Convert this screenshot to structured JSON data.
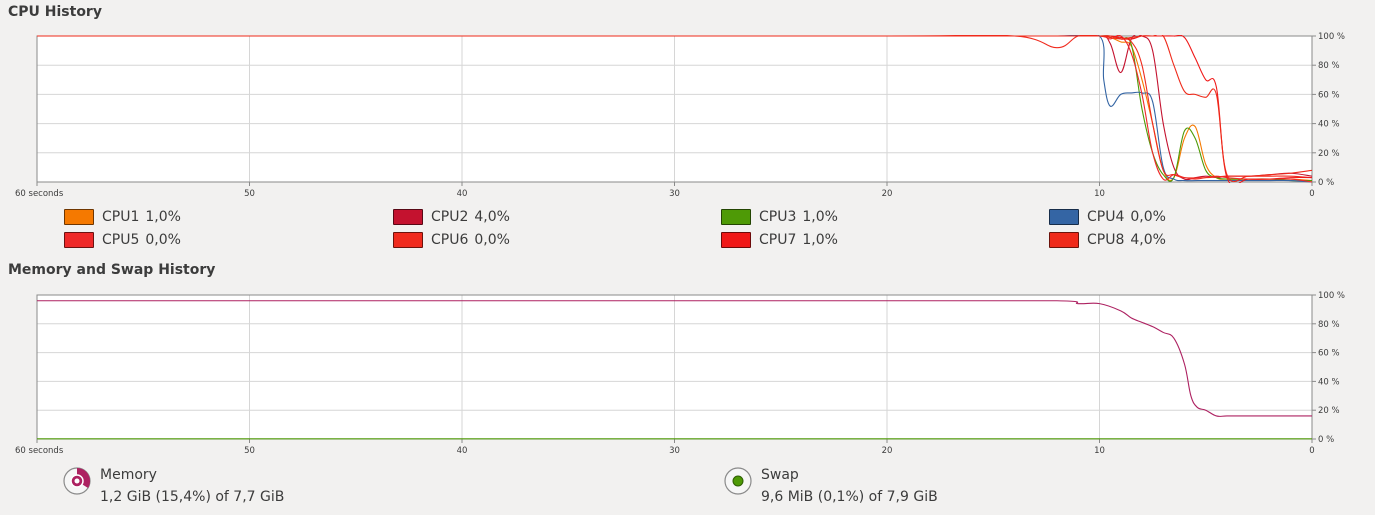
{
  "cpu": {
    "title": "CPU History",
    "x_ticks": [
      "60 seconds",
      "50",
      "40",
      "30",
      "20",
      "10",
      "0"
    ],
    "y_ticks": [
      "100 %",
      "80 %",
      "60 %",
      "40 %",
      "20 %",
      "0 %"
    ],
    "legend": [
      {
        "label": "CPU1",
        "value": "1,0%",
        "color": "#f57900"
      },
      {
        "label": "CPU2",
        "value": "4,0%",
        "color": "#c4122f"
      },
      {
        "label": "CPU3",
        "value": "1,0%",
        "color": "#4e9a06"
      },
      {
        "label": "CPU4",
        "value": "0,0%",
        "color": "#3465a4"
      },
      {
        "label": "CPU5",
        "value": "0,0%",
        "color": "#ef2929"
      },
      {
        "label": "CPU6",
        "value": "0,0%",
        "color": "#f02b1e"
      },
      {
        "label": "CPU7",
        "value": "1,0%",
        "color": "#f01818"
      },
      {
        "label": "CPU8",
        "value": "4,0%",
        "color": "#ef2a1a"
      }
    ]
  },
  "memory": {
    "title": "Memory and Swap History",
    "x_ticks": [
      "60 seconds",
      "50",
      "40",
      "30",
      "20",
      "10",
      "0"
    ],
    "y_ticks": [
      "100 %",
      "80 %",
      "60 %",
      "40 %",
      "20 %",
      "0 %"
    ],
    "memory_label": "Memory",
    "memory_value": "1,2 GiB (15,4%) of 7,7 GiB",
    "memory_color": "#ad2161",
    "swap_label": "Swap",
    "swap_value": "9,6 MiB (0,1%) of 7,9 GiB",
    "swap_color": "#4e9a06"
  },
  "chart_data": [
    {
      "type": "line",
      "title": "CPU History",
      "xlabel": "",
      "ylabel": "",
      "xlim": [
        60,
        0
      ],
      "ylim": [
        0,
        100
      ],
      "grid": true,
      "series": [
        {
          "name": "CPU1",
          "color": "#f57900",
          "x": [
            60,
            40,
            20,
            12,
            10,
            9.5,
            9,
            8.5,
            8,
            7.5,
            7,
            6.5,
            6,
            5.5,
            5,
            4.5,
            4,
            3,
            2,
            1,
            0
          ],
          "y": [
            100,
            100,
            100,
            100,
            100,
            99,
            96,
            93,
            70,
            40,
            8,
            3,
            30,
            38,
            12,
            3,
            2,
            2,
            2,
            2,
            1
          ]
        },
        {
          "name": "CPU2",
          "color": "#c4122f",
          "x": [
            60,
            40,
            20,
            12,
            10,
            9.5,
            9,
            8.5,
            8,
            7.5,
            7,
            6.5,
            6,
            5.5,
            5,
            4.5,
            4,
            3,
            2,
            1,
            0
          ],
          "y": [
            100,
            100,
            100,
            100,
            100,
            95,
            75,
            98,
            100,
            90,
            40,
            10,
            2,
            3,
            4,
            3,
            4,
            4,
            5,
            6,
            4
          ]
        },
        {
          "name": "CPU3",
          "color": "#4e9a06",
          "x": [
            60,
            40,
            20,
            12,
            10,
            9.5,
            9,
            8.5,
            8,
            7.5,
            7,
            6.5,
            6,
            5.5,
            5,
            4.5,
            4,
            3,
            2,
            1,
            0
          ],
          "y": [
            100,
            100,
            100,
            100,
            100,
            100,
            98,
            94,
            50,
            20,
            5,
            3,
            35,
            30,
            8,
            3,
            2,
            2,
            2,
            1,
            1
          ]
        },
        {
          "name": "CPU4",
          "color": "#3465a4",
          "x": [
            60,
            40,
            20,
            12,
            10,
            9.8,
            9.5,
            9,
            8.5,
            8,
            7.5,
            7,
            6.5,
            6,
            5,
            4,
            3,
            2,
            1,
            0
          ],
          "y": [
            100,
            100,
            100,
            100,
            100,
            70,
            52,
            60,
            61,
            61,
            55,
            10,
            2,
            1,
            1,
            1,
            1,
            1,
            1,
            0
          ]
        },
        {
          "name": "CPU5",
          "color": "#ef2929",
          "x": [
            60,
            40,
            20,
            12,
            10,
            9.5,
            9,
            8.5,
            8,
            7.5,
            7,
            6.5,
            6,
            5.5,
            5,
            4.5,
            4,
            3,
            2,
            1,
            0
          ],
          "y": [
            100,
            100,
            100,
            100,
            100,
            98,
            100,
            88,
            60,
            20,
            2,
            5,
            3,
            2,
            3,
            4,
            3,
            2,
            2,
            2,
            0
          ]
        },
        {
          "name": "CPU6",
          "color": "#f02b1e",
          "x": [
            60,
            40,
            20,
            14,
            12,
            11,
            10,
            9.5,
            9,
            8.5,
            8,
            7.5,
            7,
            6.5,
            6,
            5,
            4,
            3,
            2,
            1,
            0
          ],
          "y": [
            100,
            100,
            100,
            100,
            92,
            100,
            100,
            100,
            98,
            96,
            80,
            40,
            8,
            5,
            3,
            3,
            4,
            4,
            4,
            4,
            3
          ]
        },
        {
          "name": "CPU7",
          "color": "#f01818",
          "x": [
            60,
            40,
            20,
            12,
            10,
            9.5,
            9,
            8.5,
            8,
            7.5,
            7,
            6.5,
            6,
            5.5,
            5,
            4.5,
            4,
            3,
            2,
            1,
            0
          ],
          "y": [
            100,
            100,
            100,
            100,
            100,
            100,
            99,
            98,
            100,
            100,
            100,
            100,
            99,
            85,
            70,
            65,
            3,
            2,
            2,
            3,
            3
          ]
        },
        {
          "name": "CPU8",
          "color": "#ef2a1a",
          "x": [
            60,
            40,
            20,
            12,
            10,
            9.5,
            9,
            8.5,
            8,
            7.5,
            7,
            6.5,
            6,
            5.5,
            5,
            4.5,
            4,
            3,
            2,
            1,
            0
          ],
          "y": [
            100,
            100,
            100,
            100,
            100,
            99,
            98,
            99,
            100,
            100,
            100,
            80,
            62,
            60,
            58,
            60,
            5,
            4,
            5,
            6,
            8
          ]
        }
      ]
    },
    {
      "type": "line",
      "title": "Memory and Swap History",
      "xlabel": "",
      "ylabel": "",
      "xlim": [
        60,
        0
      ],
      "ylim": [
        0,
        100
      ],
      "grid": true,
      "series": [
        {
          "name": "Memory",
          "color": "#ad2161",
          "x": [
            60,
            50,
            45,
            40,
            30,
            20,
            12,
            11,
            10,
            9,
            8.5,
            8,
            7.5,
            7,
            6.5,
            6,
            5.7,
            5.4,
            5,
            4.5,
            4,
            3,
            2,
            1,
            0
          ],
          "y": [
            96,
            96,
            96,
            96,
            96,
            96,
            96,
            94,
            94,
            89,
            84,
            81,
            78,
            74,
            70,
            52,
            30,
            22,
            20,
            16,
            16,
            16,
            16,
            16,
            16
          ]
        },
        {
          "name": "Swap",
          "color": "#4e9a06",
          "x": [
            60,
            0
          ],
          "y": [
            0.1,
            0.1
          ]
        }
      ]
    }
  ]
}
